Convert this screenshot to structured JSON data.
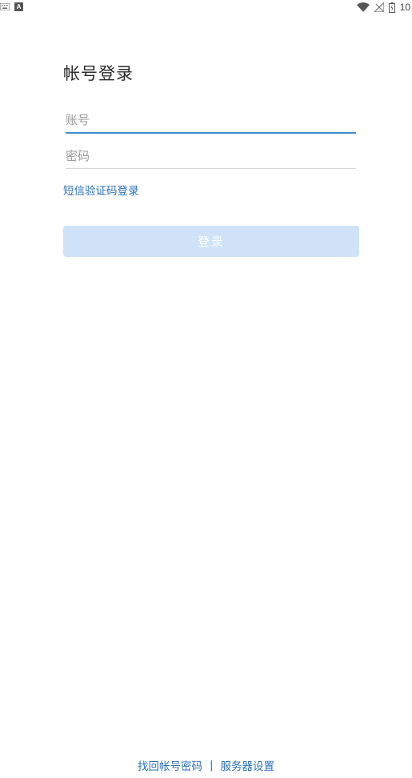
{
  "status_bar": {
    "left_icons": [
      "keyboard-icon",
      "a-letter-icon"
    ],
    "a_badge": "A",
    "right_icons": [
      "wifi-icon",
      "no-signal-icon",
      "battery-icon"
    ],
    "time": "10"
  },
  "login": {
    "title": "帐号登录",
    "account_placeholder": "账号",
    "password_placeholder": "密码",
    "account_value": "",
    "password_value": "",
    "sms_login_link": "短信验证码登录",
    "login_button": "登录"
  },
  "footer": {
    "recover_link": "找回帐号密码",
    "separator": "|",
    "server_settings_link": "服务器设置"
  },
  "colors": {
    "accent": "#3d8bd0",
    "link": "#2c72b8",
    "button_disabled_bg": "#cfe2f8"
  }
}
